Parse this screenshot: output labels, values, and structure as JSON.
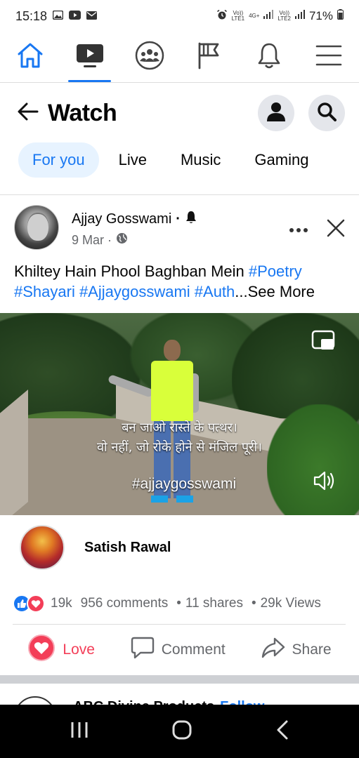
{
  "status_bar": {
    "time": "15:18",
    "sim1": "Vo))\nLTE1",
    "net": "4G+",
    "sim2": "Vo))\nLTE2",
    "battery": "71%"
  },
  "nav": {
    "items": [
      {
        "name": "home-icon"
      },
      {
        "name": "watch-icon",
        "active": true
      },
      {
        "name": "groups-icon"
      },
      {
        "name": "pages-flag-icon"
      },
      {
        "name": "notifications-bell-icon"
      },
      {
        "name": "menu-icon"
      }
    ],
    "accent": "#1877f2"
  },
  "header": {
    "title": "Watch"
  },
  "tabs": [
    {
      "label": "For you",
      "active": true
    },
    {
      "label": "Live"
    },
    {
      "label": "Music"
    },
    {
      "label": "Gaming"
    }
  ],
  "post": {
    "author": "Ajjay Gosswami",
    "date": "9 Mar ·",
    "caption_text": "Khiltey Hain Phool Baghban Mein ",
    "tags_line1": "#Poetry",
    "tags_line2": "#Shayari #Ajjaygosswami #Auth",
    "see_more": "...See More",
    "video": {
      "lyrics_line1": "बन जाओ रास्ते के पत्थर।",
      "lyrics_line2": "वो नहीं, जो रोके होने से मंजिल पूरी।",
      "hashtag": "#ajjaygosswami"
    },
    "commenter": "Satish Rawal",
    "reactions_count": "19k",
    "comments": "956 comments",
    "shares": "11 shares",
    "views": "29k Views",
    "actions": {
      "love": "Love",
      "comment": "Comment",
      "share": "Share"
    }
  },
  "next_post": {
    "author_partial": "ABC Divine Products",
    "follow": "Follow"
  },
  "colors": {
    "love": "#f33e58",
    "link": "#1877f2",
    "secondary_text": "#65676b"
  }
}
